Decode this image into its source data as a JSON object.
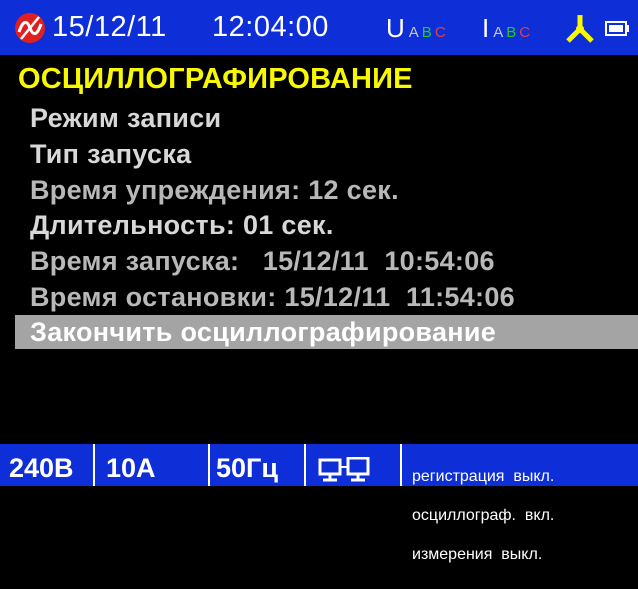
{
  "header": {
    "date": "15/12/11",
    "time": "12:04:00",
    "voltage_label": "U",
    "current_label": "I",
    "phases": [
      "A",
      "B",
      "C"
    ],
    "colors": {
      "bar": "#0e2ed8",
      "phase_a": "#c9c9c9",
      "phase_b": "#20d020",
      "phase_c": "#e04040",
      "logo": "#e02020",
      "title": "#f8f800"
    }
  },
  "menu": {
    "title": "ОСЦИЛЛОГРАФИРОВАНИЕ",
    "items": [
      {
        "label": "Режим записи"
      },
      {
        "label": "Тип запуска"
      },
      {
        "label": "Время упреждения: 12 сек."
      },
      {
        "label": "Длительность: 01 сек."
      },
      {
        "label": "Время запуска:   15/12/11  10:54:06"
      },
      {
        "label": "Время остановки: 15/12/11  11:54:06"
      },
      {
        "label": "Закончить осциллографирование",
        "selected": true
      }
    ]
  },
  "footer": {
    "voltage": "240В",
    "current": "10А",
    "frequency": "50Гц",
    "status_lines": [
      "регистрация  выкл.",
      "осциллограф.  вкл.",
      "измерения  выкл."
    ]
  }
}
